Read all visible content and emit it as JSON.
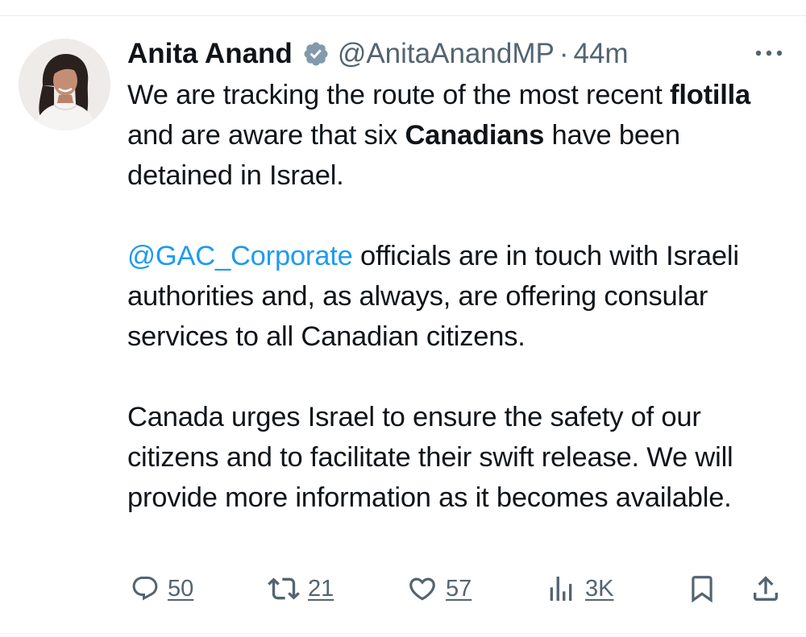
{
  "author": {
    "name": "Anita Anand",
    "handle": "@AnitaAnandMP",
    "separator": "·",
    "time": "44m",
    "avatar_icon": "profile-photo"
  },
  "tweet": {
    "p1": {
      "t1": "We are tracking the route of the most recent ",
      "b1": "flotilla",
      "t2": " and are aware that six ",
      "b2": "Canadians",
      "t3": " have been detained in Israel."
    },
    "p2": {
      "mention": "@GAC_Corporate",
      "t1": " officials are in touch with Israeli authorities and, as always, are offering consular services to all Canadian citizens."
    },
    "p3": "Canada urges Israel to ensure the safety of our citizens and to facilitate their swift release. We will provide more information as it becomes available."
  },
  "actions": {
    "replies": "50",
    "reposts": "21",
    "likes": "57",
    "views": "3K"
  },
  "colors": {
    "text": "#0f1419",
    "secondary": "#536471",
    "link": "#1d9bf0",
    "verified": "#829aab"
  }
}
